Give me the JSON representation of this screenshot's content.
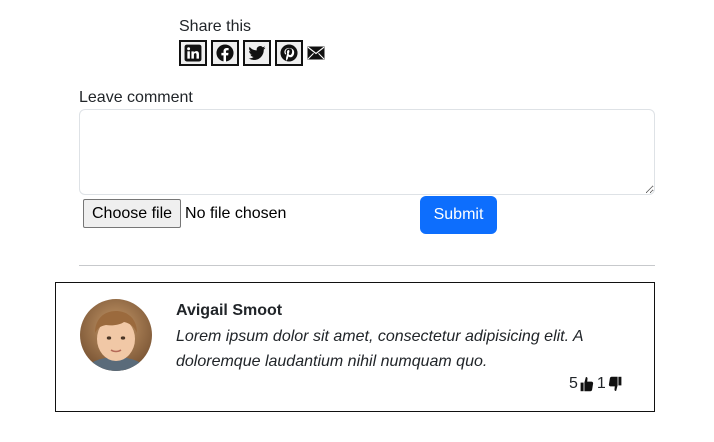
{
  "share": {
    "label": "Share this",
    "icons": [
      "linkedin-icon",
      "facebook-icon",
      "twitter-icon",
      "pinterest-icon",
      "mail-icon"
    ]
  },
  "comment_form": {
    "label": "Leave comment",
    "textarea_value": "",
    "file_button_label": "Choose file",
    "file_status": "No file chosen",
    "submit_label": "Submit",
    "submit_color": "#0d6efd"
  },
  "comment": {
    "author": "Avigail Smoot",
    "text": "Lorem ipsum dolor sit amet, consectetur adipisicing elit. A doloremque laudantium nihil numquam quo.",
    "likes": "5",
    "dislikes": "1",
    "like_icon": "thumbs-up-icon",
    "dislike_icon": "thumbs-down-icon"
  }
}
